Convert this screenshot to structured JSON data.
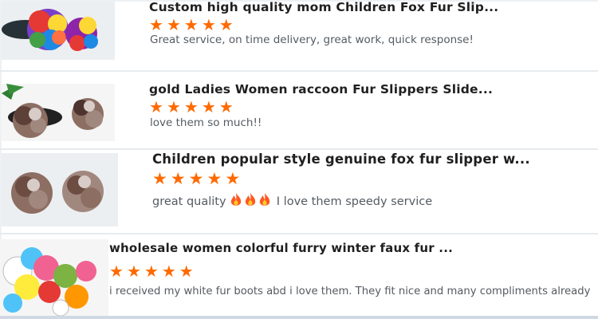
{
  "reviews": [
    {
      "title": "Custom high quality mom Children Fox Fur Slip...",
      "rating": 5,
      "comment": "Great service, on time delivery, great work, quick response!",
      "thumb_colors": [
        "#7a3fc9",
        "#e53935",
        "#fdd835",
        "#43a047",
        "#1e88e5",
        "#ff7043"
      ]
    },
    {
      "title": "gold Ladies Women raccoon Fur Slippers Slide...",
      "rating": 5,
      "comment": "love them so much!!",
      "thumb_colors": [
        "#8d6e63",
        "#5d4037",
        "#a1887f",
        "#d7ccc8",
        "#4e342e"
      ]
    },
    {
      "title": "Children popular style genuine fox fur slipper w...",
      "rating": 5,
      "comment_before": "great quality",
      "comment_emoji_icon": "fire-icon",
      "comment_emoji_count": 3,
      "comment_after": "I love them speedy service",
      "thumb_colors": [
        "#a1887f",
        "#8d6e63",
        "#6d4c41",
        "#d7ccc8"
      ]
    },
    {
      "title": "wholesale women colorful furry winter faux fur ...",
      "rating": 5,
      "comment": "i received my white fur boots abd i love them. They fit nice and many compliments already",
      "thumb_colors": [
        "#f06292",
        "#ffeb3b",
        "#4fc3f7",
        "#e53935",
        "#ffffff",
        "#7cb342",
        "#ff9800"
      ]
    }
  ],
  "star_icon": "star-icon",
  "star_color": "#ff6a00"
}
